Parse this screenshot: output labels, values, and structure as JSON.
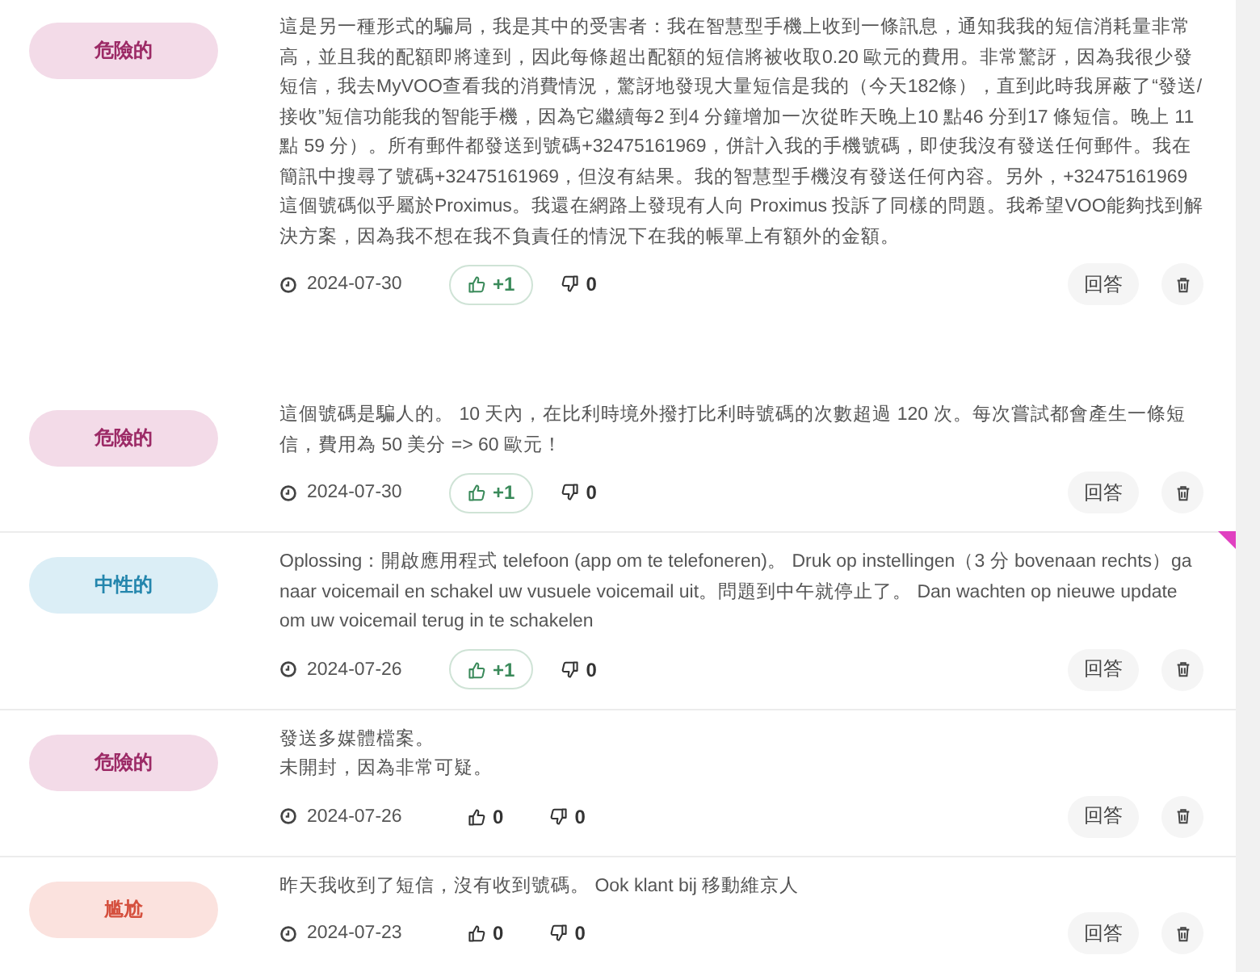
{
  "comments": [
    {
      "badge": {
        "label": "危險的",
        "kind": "danger"
      },
      "text": "這是另一種形式的騙局，我是其中的受害者：我在智慧型手機上收到一條訊息，通知我我的短信消耗量非常高，並且我的配額即將達到，因此每條超出配額的短信將被收取0.20 歐元的費用。非常驚訝，因為我很少發短信，我去MyVOO查看我的消費情況，驚訝地發現大量短信是我的（今天182條），直到此時我屏蔽了“發送/接收”短信功能我的智能手機，因為它繼續每2 到4 分鐘增加一次從昨天晚上10 點46 分到17 條短信。晚上 11 點 59 分）。所有郵件都發送到號碼+32475161969，併計入我的手機號碼，即使我沒有發送任何郵件。我在簡訊中搜尋了號碼+32475161969，但沒有結果。我的智慧型手機沒有發送任何內容。另外，+32475161969這個號碼似乎屬於Proximus。我還在網路上發現有人向 Proximus 投訴了同樣的問題。我希望VOO能夠找到解決方案，因為我不想在我不負責任的情況下在我的帳單上有額外的金額。",
      "date": "2024-07-30",
      "likes": "+1",
      "liked": true,
      "dislikes": "0",
      "reply": "回答"
    },
    {
      "badge": {
        "label": "危險的",
        "kind": "danger"
      },
      "text": "這個號碼是騙人的。 10 天內，在比利時境外撥打比利時號碼的次數超過 120 次。每次嘗試都會產生一條短信，費用為 50 美分 => 60 歐元！",
      "date": "2024-07-30",
      "likes": "+1",
      "liked": true,
      "dislikes": "0",
      "reply": "回答"
    },
    {
      "badge": {
        "label": "中性的",
        "kind": "neutral"
      },
      "text": "Oplossing：開啟應用程式 telefoon (app om te telefoneren)。 Druk op instellingen（3 分 bovenaan rechts）ga naar voicemail en schakel uw vusuele voicemail uit。問題到中午就停止了。 Dan wachten op nieuwe update om uw voicemail terug in te schakelen",
      "date": "2024-07-26",
      "likes": "+1",
      "liked": true,
      "dislikes": "0",
      "reply": "回答"
    },
    {
      "badge": {
        "label": "危險的",
        "kind": "danger"
      },
      "text": "發送多媒體檔案。",
      "text_2": "未開封，因為非常可疑。",
      "date": "2024-07-26",
      "likes": "0",
      "liked": false,
      "dislikes": "0",
      "reply": "回答"
    },
    {
      "badge": {
        "label": "尴尬",
        "kind": "awkward"
      },
      "text": "昨天我收到了短信，沒有收到號碼。 Ook klant bij 移動維京人",
      "date": "2024-07-23",
      "likes": "0",
      "liked": false,
      "dislikes": "0",
      "reply": "回答"
    }
  ]
}
